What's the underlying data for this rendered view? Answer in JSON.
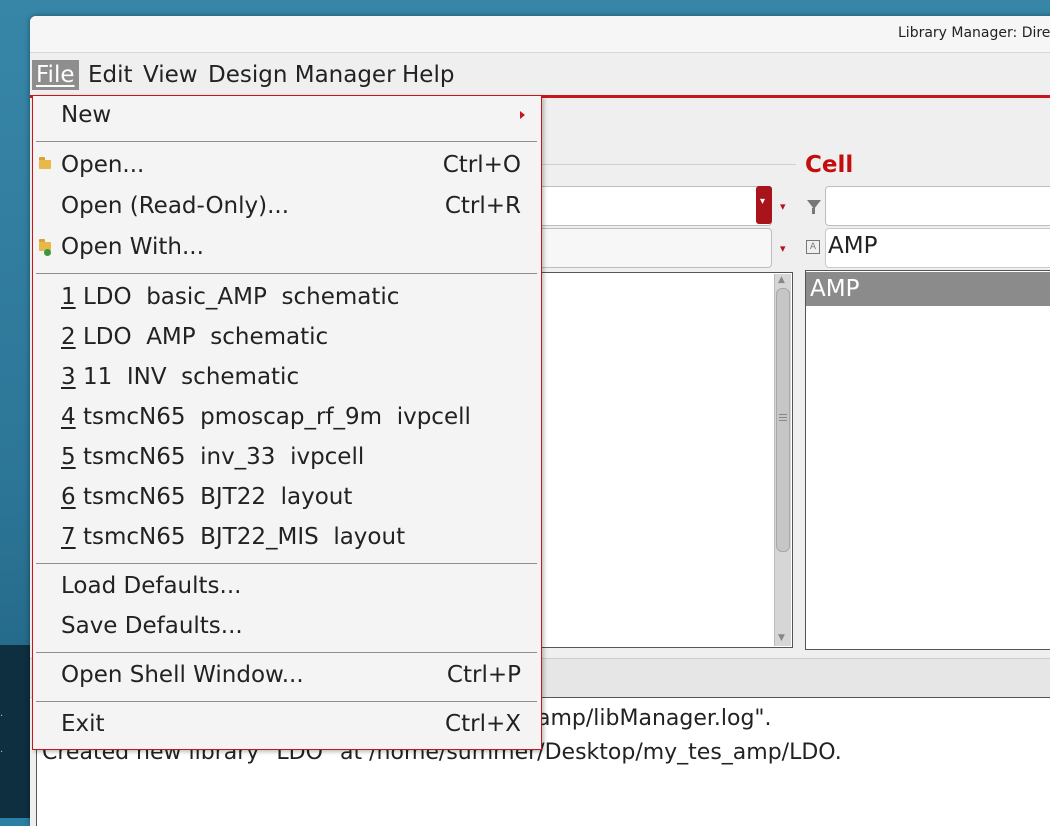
{
  "window": {
    "title": "Library Manager: Direc"
  },
  "menubar": {
    "file": "File",
    "edit": "Edit",
    "view": "View",
    "design_manager": "Design Manager",
    "help": "Help"
  },
  "file_menu": {
    "new": "New",
    "open": "Open...",
    "open_shortcut": "Ctrl+O",
    "open_readonly": "Open (Read-Only)...",
    "open_readonly_shortcut": "Ctrl+R",
    "open_with": "Open With...",
    "recent": [
      {
        "num": "1",
        "text": " LDO  basic_AMP  schematic"
      },
      {
        "num": "2",
        "text": " LDO  AMP  schematic"
      },
      {
        "num": "3",
        "text": " 11  INV  schematic"
      },
      {
        "num": "4",
        "text": " tsmcN65  pmoscap_rf_9m  ivpcell"
      },
      {
        "num": "5",
        "text": " tsmcN65  inv_33  ivpcell"
      },
      {
        "num": "6",
        "text": " tsmcN65  BJT22  layout"
      },
      {
        "num": "7",
        "text": " tsmcN65  BJT22_MIS  layout"
      }
    ],
    "load_defaults": "Load Defaults...",
    "save_defaults": "Save Defaults...",
    "open_shell": "Open Shell Window...",
    "open_shell_shortcut": "Ctrl+P",
    "exit": "Exit",
    "exit_shortcut": "Ctrl+X"
  },
  "cell_panel": {
    "label": "Cell",
    "search_value": "AMP",
    "items": [
      "AMP"
    ]
  },
  "log": {
    "line1": "amp/libManager.log\".",
    "line2": "Created new library \"LDO\" at /home/summer/Desktop/my_tes_amp/LDO."
  },
  "colors": {
    "accent": "#c8161d",
    "selection": "#8b8b8b"
  }
}
